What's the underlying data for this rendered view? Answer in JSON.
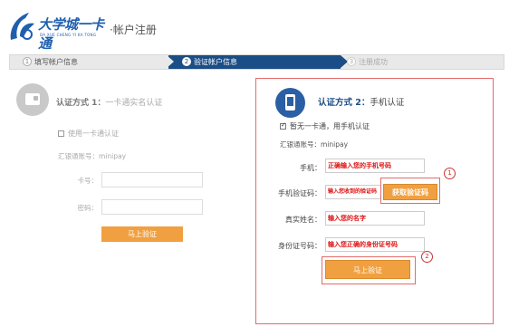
{
  "header": {
    "logo_name": "大学城一卡通",
    "logo_pinyin": "DA XUE CHENG YI KA TONG",
    "page_title": "·帐户注册"
  },
  "steps": [
    {
      "num": "1",
      "label": "填写帐户信息"
    },
    {
      "num": "2",
      "label": "验证帐户信息"
    },
    {
      "num": "3",
      "label": "注册成功"
    }
  ],
  "left": {
    "heading_main": "认证方式 1：",
    "heading_sub": "一卡通实名认证",
    "checkbox_label": "使用一卡通认证",
    "account_text": "汇银通账号：minipay",
    "card_label": "卡号：",
    "password_label": "密码：",
    "submit_label": "马上验证"
  },
  "right": {
    "heading_main": "认证方式 2：",
    "heading_sub": "手机认证",
    "checkbox_label": "暂无一卡通，用手机认证",
    "account_text": "汇银通账号：minipay",
    "phone_label": "手机：",
    "phone_value": "正确输入您的手机号码",
    "code_label": "手机验证码：",
    "code_value": "输入您收到的验证码",
    "get_code_label": "获取验证码",
    "name_label": "真实姓名：",
    "name_value": "输入您的名字",
    "id_label": "身份证号码：",
    "id_value": "输入您正确的身份证号码",
    "submit_label": "马上验证",
    "badge_1": "1",
    "badge_2": "2"
  },
  "colors": {
    "brand_blue": "#1b4d86",
    "button_orange": "#f0a040",
    "highlight_red": "#e46b6b"
  }
}
